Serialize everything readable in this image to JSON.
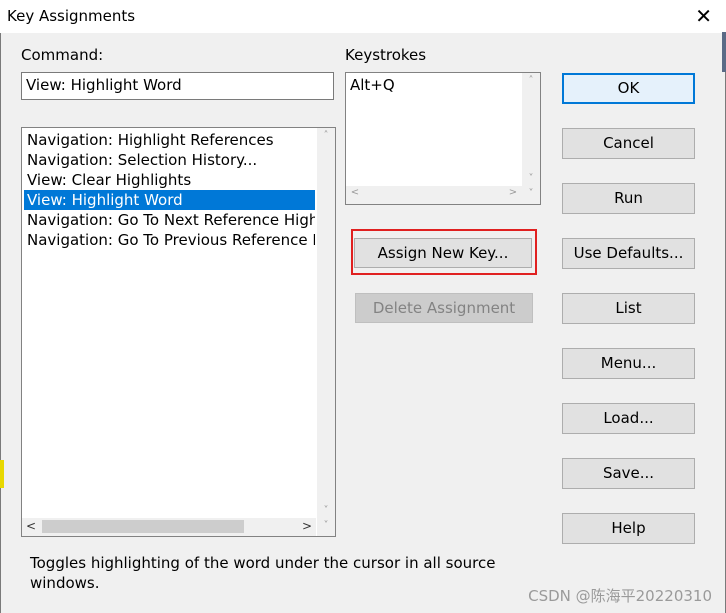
{
  "window": {
    "title": "Key Assignments",
    "close_glyph": "✕"
  },
  "command": {
    "label": "Command:",
    "value": "View: Highlight Word"
  },
  "command_list": {
    "items": [
      "Navigation: Highlight References",
      "Navigation: Selection History...",
      "View: Clear Highlights",
      "View: Highlight Word",
      "Navigation: Go To Next Reference Highlight",
      "Navigation: Go To Previous Reference Highlight"
    ],
    "selected_index": 3,
    "scroll": {
      "up": "˄",
      "down": "˅",
      "left": "<",
      "right": ">"
    }
  },
  "keystrokes": {
    "label": "Keystrokes",
    "value": "Alt+Q",
    "scroll": {
      "up": "˄",
      "down": "˅",
      "left": "<",
      "right": ">"
    }
  },
  "buttons": {
    "ok": "OK",
    "cancel": "Cancel",
    "run": "Run",
    "use_defaults": "Use Defaults...",
    "list": "List",
    "menu": "Menu...",
    "load": "Load...",
    "save": "Save...",
    "help": "Help",
    "assign_new_key": "Assign New Key...",
    "delete_assignment": "Delete Assignment"
  },
  "description": "Toggles highlighting of the word under the cursor in all source windows.",
  "watermark": "CSDN @陈海平20220310",
  "colors": {
    "selection": "#0078d7",
    "highlight_box": "#e02020",
    "accent": "#0078d7"
  }
}
